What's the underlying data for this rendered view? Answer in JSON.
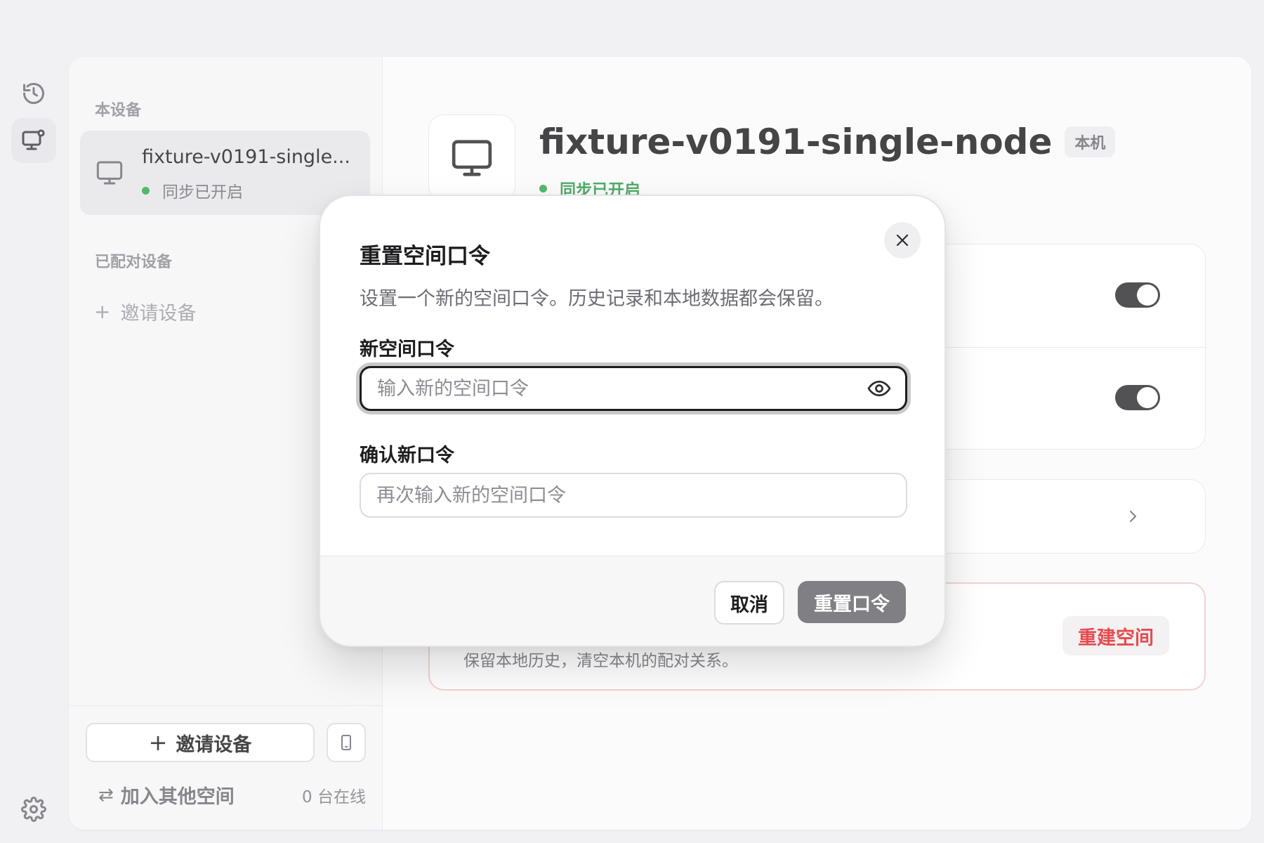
{
  "sidebar": {
    "this_device_label": "本设备",
    "current_device": {
      "name": "fixture-v0191-single...",
      "status": "同步已开启"
    },
    "paired_label": "已配对设备",
    "invite_link": "邀请设备",
    "footer": {
      "invite_button": "邀请设备",
      "join_link": "加入其他空间",
      "online_count": "0 台在线"
    }
  },
  "main": {
    "device_name": "fixture-v0191-single-node",
    "badge": "本机",
    "status": "同步已开启",
    "danger": {
      "description": "保留本地历史，清空本机的配对关系。",
      "rebuild_button": "重建空间"
    }
  },
  "modal": {
    "title": "重置空间口令",
    "description": "设置一个新的空间口令。历史记录和本地数据都会保留。",
    "new_label": "新空间口令",
    "new_placeholder": "输入新的空间口令",
    "confirm_label": "确认新口令",
    "confirm_placeholder": "再次输入新的空间口令",
    "cancel_button": "取消",
    "reset_button": "重置口令"
  },
  "icons": {
    "rail": [
      "history-icon",
      "device-settings-icon",
      "gear-icon"
    ],
    "eye": "eye-icon",
    "close": "close-icon"
  },
  "colors": {
    "accent_green": "#2a9a48",
    "danger_red": "#e0242a",
    "toggle_on": "#2c2c30",
    "disabled_button": "#7f7f84"
  }
}
